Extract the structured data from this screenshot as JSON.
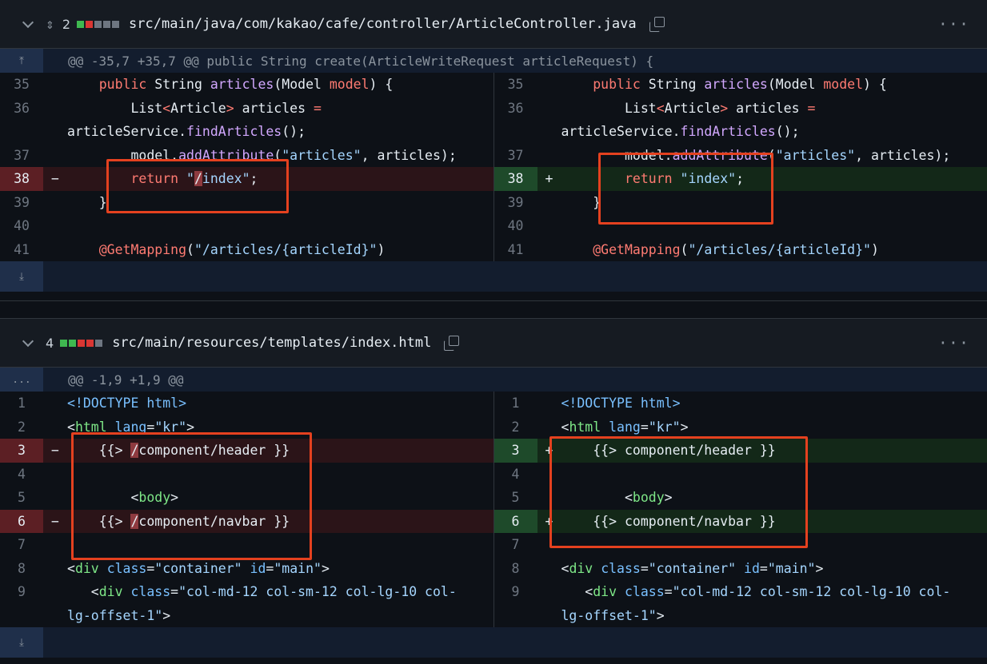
{
  "file1": {
    "count": "2",
    "diffstat": [
      "add",
      "del",
      "neu",
      "neu",
      "neu"
    ],
    "path": "src/main/java/com/kakao/cafe/controller/ArticleController.java",
    "hunk_header": "@@ -35,7 +35,7 @@ public String create(ArticleWriteRequest articleRequest) {",
    "rows": [
      {
        "ln": "35",
        "type": "ctx",
        "left": [
          "    ",
          [
            "kw",
            "public"
          ],
          " String ",
          [
            "fn",
            "articles"
          ],
          "(Model ",
          [
            "kw",
            "model"
          ],
          ") {"
        ]
      },
      {
        "ln": "36",
        "type": "ctx",
        "left": [
          "        List",
          [
            "kw",
            "<"
          ],
          "Article",
          [
            "kw",
            ">"
          ],
          " articles ",
          [
            "kw",
            "="
          ]
        ]
      },
      {
        "ln": "",
        "type": "ctx",
        "left": [
          "articleService.",
          [
            "fn",
            "findArticles"
          ],
          "();"
        ]
      },
      {
        "ln": "37",
        "type": "ctx",
        "left": [
          "        model.",
          [
            "fn",
            "addAttribute"
          ],
          "(",
          [
            "str",
            "\"articles\""
          ],
          ", articles);"
        ]
      },
      {
        "ln": "38",
        "type": "change",
        "left": [
          "        ",
          [
            "kw",
            "return"
          ],
          " ",
          [
            "str",
            "\""
          ],
          [
            "del",
            "/"
          ],
          [
            "str",
            "index\""
          ],
          ";"
        ],
        "right": [
          "        ",
          [
            "kw",
            "return"
          ],
          " ",
          [
            "str",
            "\"index\""
          ],
          ";"
        ]
      },
      {
        "ln": "39",
        "type": "ctx",
        "left": [
          "    }"
        ]
      },
      {
        "ln": "40",
        "type": "ctx",
        "left": [
          ""
        ]
      },
      {
        "ln": "41",
        "type": "ctx",
        "left": [
          "    ",
          [
            "kw",
            "@GetMapping"
          ],
          "(",
          [
            "str",
            "\"/articles/{articleId}\""
          ],
          ")"
        ]
      }
    ]
  },
  "file2": {
    "count": "4",
    "diffstat": [
      "add",
      "add",
      "del",
      "del",
      "neu"
    ],
    "path": "src/main/resources/templates/index.html",
    "hunk_button": "...",
    "hunk_header": "@@ -1,9 +1,9 @@",
    "rows": [
      {
        "ln": "1",
        "type": "ctx",
        "left": [
          [
            "attr",
            "<!DOCTYPE html>"
          ]
        ]
      },
      {
        "ln": "2",
        "type": "ctx",
        "left": [
          "<",
          [
            "tag",
            "html"
          ],
          " ",
          [
            "attr",
            "lang"
          ],
          "=",
          [
            "str",
            "\"kr\""
          ],
          ">"
        ]
      },
      {
        "ln": "3",
        "type": "change",
        "left": [
          "    {{> ",
          [
            "del",
            "/"
          ],
          "component/header }}"
        ],
        "right": [
          "    {{> component/header }}"
        ]
      },
      {
        "ln": "4",
        "type": "ctx",
        "left": [
          ""
        ]
      },
      {
        "ln": "5",
        "type": "ctx",
        "left": [
          "        <",
          [
            "tag",
            "body"
          ],
          ">"
        ]
      },
      {
        "ln": "6",
        "type": "change",
        "left": [
          "    {{> ",
          [
            "del",
            "/"
          ],
          "component/navbar }}"
        ],
        "right": [
          "    {{> component/navbar }}"
        ]
      },
      {
        "ln": "7",
        "type": "ctx",
        "left": [
          ""
        ]
      },
      {
        "ln": "8",
        "type": "ctx",
        "left": [
          "<",
          [
            "tag",
            "div"
          ],
          " ",
          [
            "attr",
            "class"
          ],
          "=",
          [
            "str",
            "\"container\""
          ],
          " ",
          [
            "attr",
            "id"
          ],
          "=",
          [
            "str",
            "\"main\""
          ],
          ">"
        ]
      },
      {
        "ln": "9",
        "type": "ctx",
        "left": [
          "   <",
          [
            "tag",
            "div"
          ],
          " ",
          [
            "attr",
            "class"
          ],
          "=",
          [
            "str",
            "\"col-md-12 col-sm-12 col-lg-10 col-"
          ]
        ]
      },
      {
        "ln": "",
        "type": "ctx",
        "left": [
          [
            "str",
            "lg-offset-1\""
          ],
          ">"
        ]
      }
    ]
  },
  "markers": {
    "del": "−",
    "add": "+"
  },
  "colors": {
    "highlight_box": "#e4411f",
    "add_bg": "#132818",
    "del_bg": "#2b1418",
    "hunk_bg": "#131d2e"
  }
}
